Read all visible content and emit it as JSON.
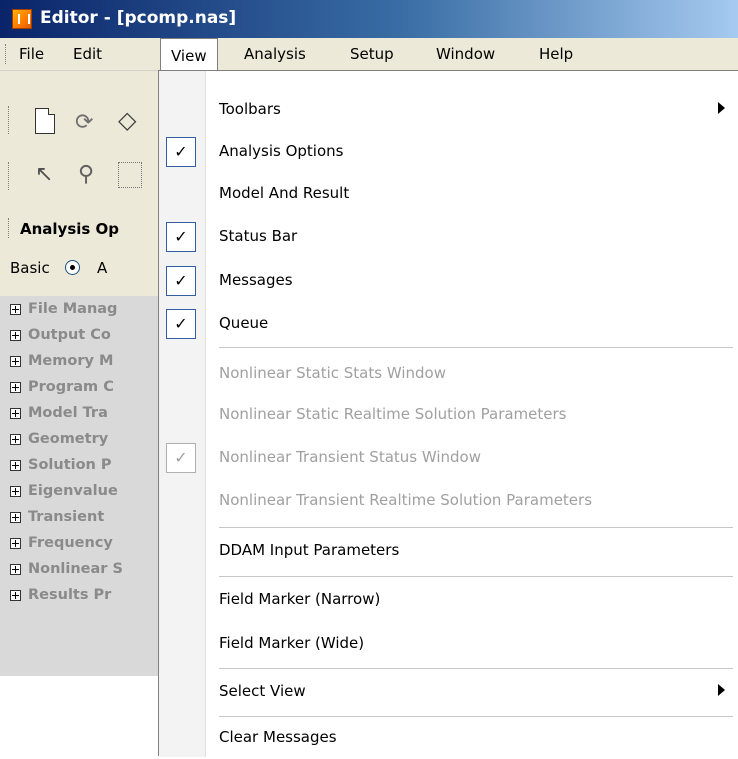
{
  "window": {
    "title": "Editor - [pcomp.nas]"
  },
  "menubar": {
    "items": [
      "File",
      "Edit",
      "View",
      "Analysis",
      "Setup",
      "Window",
      "Help"
    ],
    "open_item": "View"
  },
  "left_panel": {
    "section_title": "Analysis Op",
    "mode_basic": "Basic",
    "mode_other": "A",
    "tree_items": [
      "File Manag",
      "Output Co",
      "Memory M",
      "Program C",
      "Model Tra",
      "Geometry",
      "Solution P",
      "Eigenvalue",
      "Transient",
      "Frequency",
      "Nonlinear S",
      "Results Pr"
    ]
  },
  "view_menu": {
    "items": [
      {
        "label": "Toolbars",
        "checked": false,
        "enabled": true,
        "submenu": true
      },
      {
        "label": "Analysis Options",
        "checked": true,
        "enabled": true
      },
      {
        "label": "Model And Result",
        "checked": false,
        "enabled": true
      },
      {
        "label": "Status Bar",
        "checked": true,
        "enabled": true
      },
      {
        "label": "Messages",
        "checked": true,
        "enabled": true
      },
      {
        "label": "Queue",
        "checked": true,
        "enabled": true
      },
      {
        "label": "Nonlinear Static Stats Window",
        "checked": false,
        "enabled": false
      },
      {
        "label": "Nonlinear Static Realtime Solution Parameters",
        "checked": false,
        "enabled": false
      },
      {
        "label": "Nonlinear Transient Status Window",
        "checked": true,
        "enabled": false
      },
      {
        "label": "Nonlinear Transient Realtime Solution Parameters",
        "checked": false,
        "enabled": false
      },
      {
        "label": "DDAM Input Parameters",
        "checked": false,
        "enabled": true
      },
      {
        "label": "Field Marker (Narrow)",
        "checked": false,
        "enabled": true
      },
      {
        "label": "Field Marker (Wide)",
        "checked": false,
        "enabled": true
      },
      {
        "label": "Select View",
        "checked": false,
        "enabled": true,
        "submenu": true
      },
      {
        "label": "Clear Messages",
        "checked": false,
        "enabled": true
      }
    ],
    "checkmark_glyph": "✓"
  },
  "colors": {
    "menu_bg": "#ece9d8",
    "check_border": "#315ea0",
    "disabled_text": "#a0a0a0",
    "title_bar": "#0a246a"
  }
}
